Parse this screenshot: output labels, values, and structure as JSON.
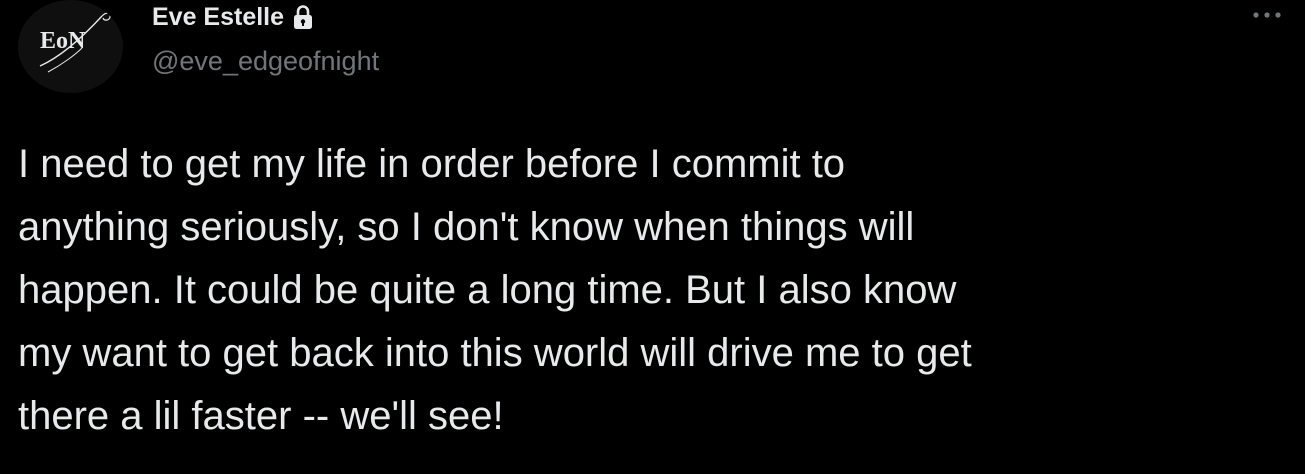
{
  "author": {
    "avatar_text": "EoN",
    "display_name": "Eve Estelle",
    "handle": "@eve_edgeofnight",
    "protected_icon": "lock-icon"
  },
  "menu": {
    "icon": "more-horizontal-icon"
  },
  "tweet": {
    "text": "I need to get my life in order before I commit to\nanything seriously, so I don't know when things will\nhappen. It could be quite a long time. But I also know\nmy want to get back into this world will drive me to get\nthere a lil faster -- we'll see!"
  },
  "colors": {
    "background": "#000000",
    "primary_text": "#e7e9ea",
    "secondary_text": "#71767b"
  }
}
